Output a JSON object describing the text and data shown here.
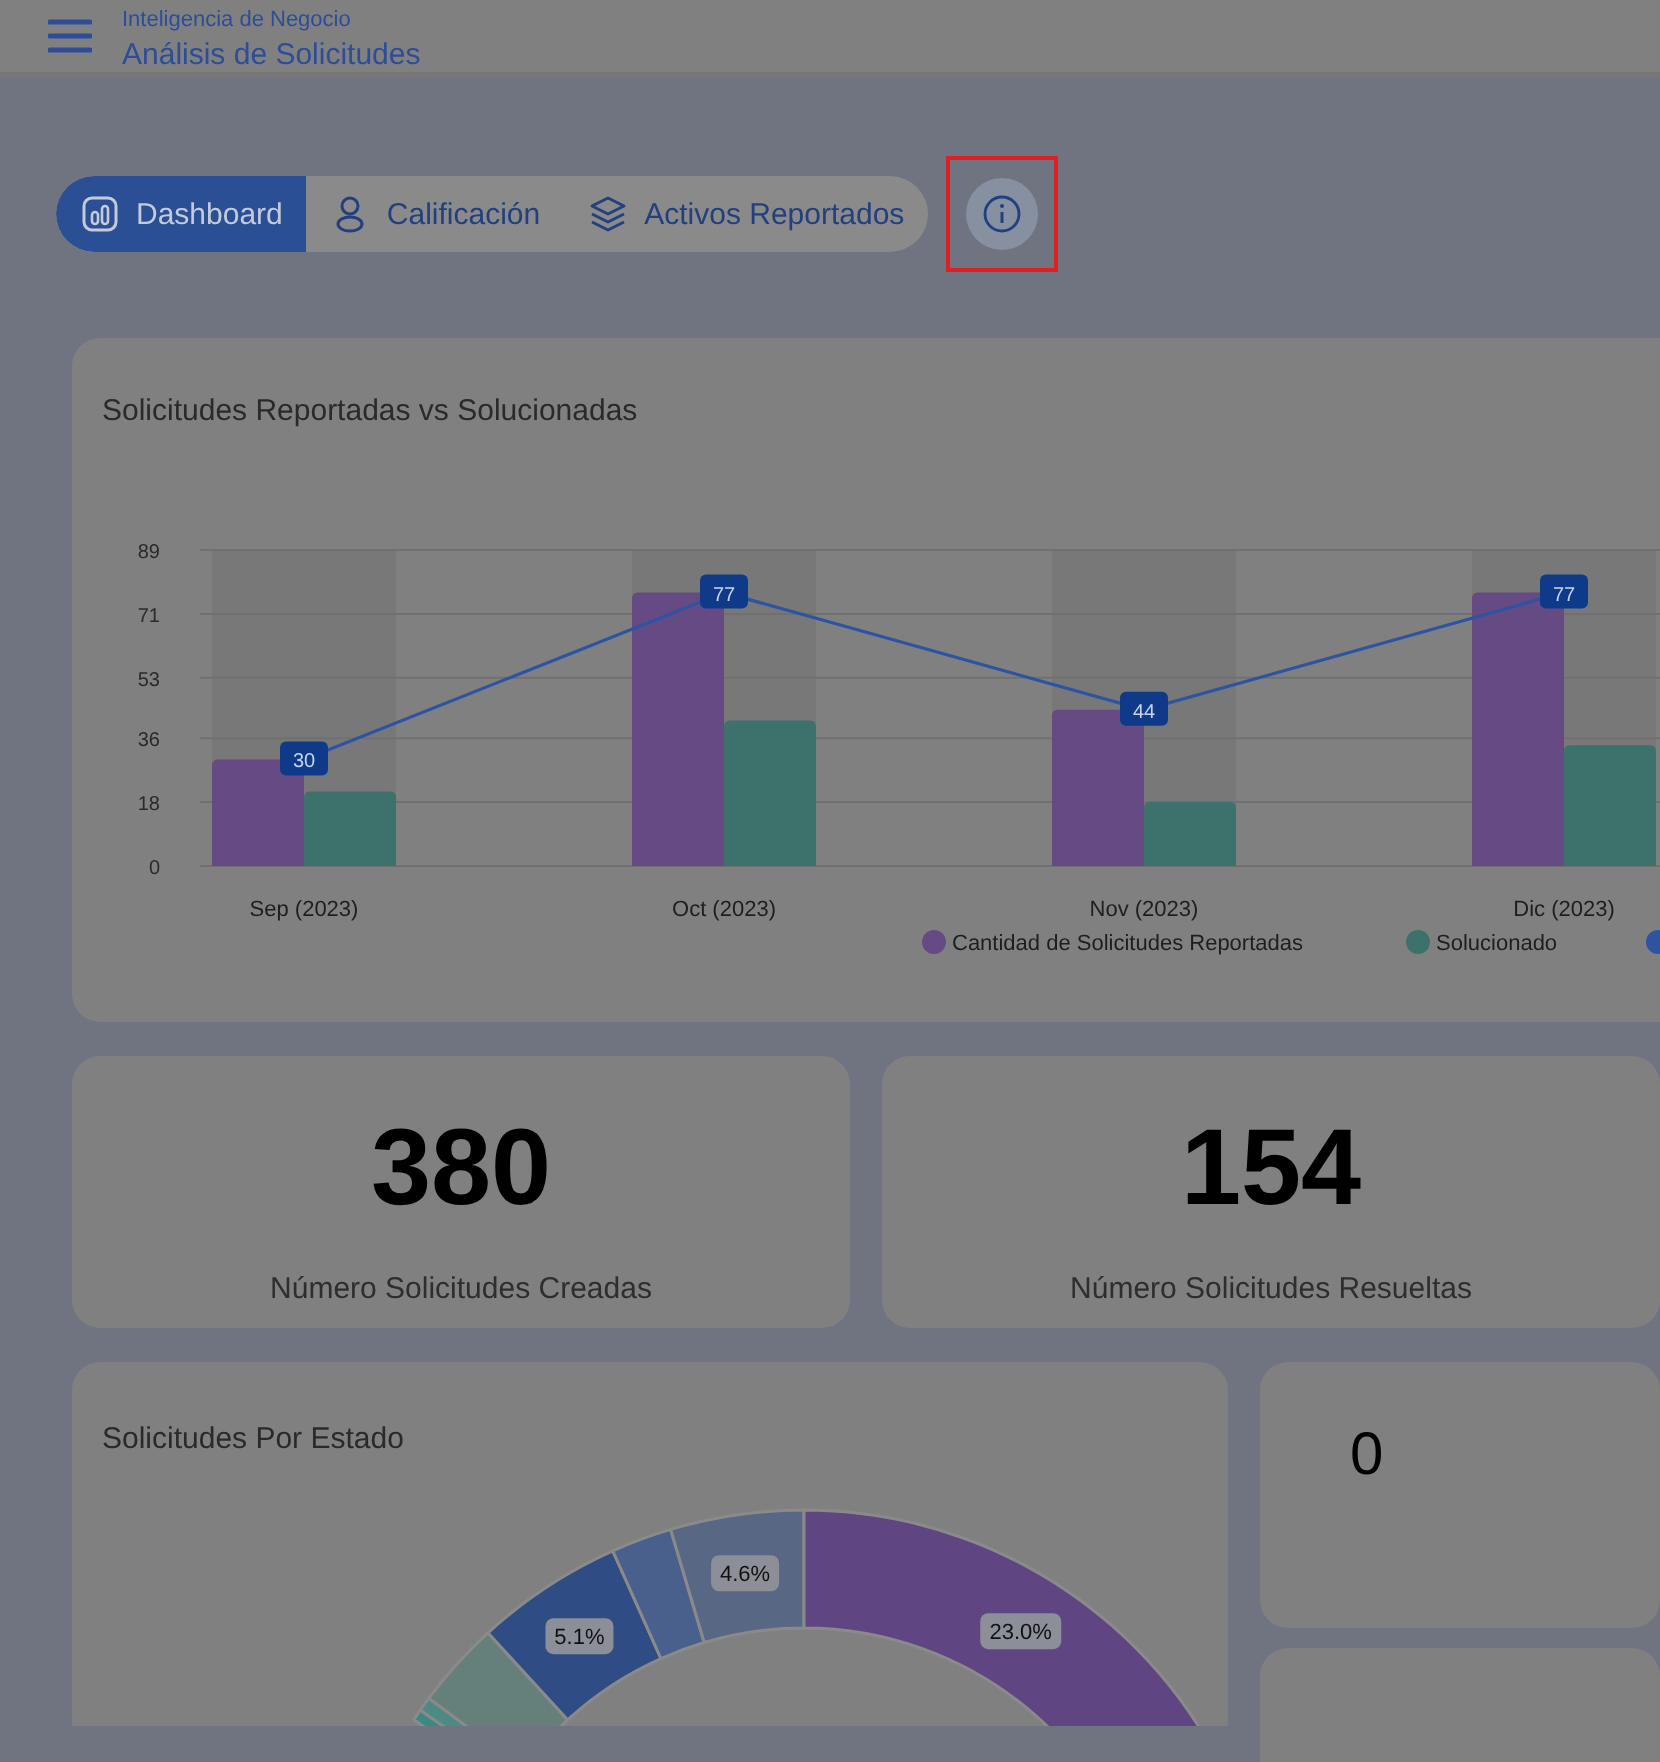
{
  "header": {
    "subtitle": "Inteligencia de Negocio",
    "title": "Análisis de Solicitudes"
  },
  "tabs": [
    {
      "label": "Dashboard",
      "selected": true
    },
    {
      "label": "Calificación",
      "selected": false
    },
    {
      "label": "Activos Reportados",
      "selected": false
    }
  ],
  "info_button": {
    "highlighted": true
  },
  "requests_chart": {
    "title": "Solicitudes Reportadas vs Solucionadas",
    "chart_data": {
      "type": "bar",
      "categories": [
        "Sep (2023)",
        "Oct (2023)",
        "Nov (2023)",
        "Dic (2023)"
      ],
      "ylim": [
        0,
        89
      ],
      "yticks": [
        0,
        18,
        36,
        53,
        71,
        89
      ],
      "series": [
        {
          "name": "Cantidad de Solicitudes Reportadas",
          "color": "#654a84",
          "values": [
            30,
            77,
            44,
            77
          ],
          "type": "bar"
        },
        {
          "name": "Solucionado",
          "color": "#3d716b",
          "values": [
            21,
            41,
            18,
            34
          ],
          "type": "bar"
        },
        {
          "color": "#2c54a3",
          "values": [
            30,
            77,
            44,
            77
          ],
          "type": "line",
          "marker": "square",
          "value_labels": [
            "30",
            "77",
            "44",
            "77"
          ]
        }
      ],
      "stacked": false,
      "grid": true,
      "legend": "bottom"
    }
  },
  "kpis": [
    {
      "value": "380",
      "label": "Número Solicitudes Creadas"
    },
    {
      "value": "154",
      "label": "Número Solicitudes Resueltas"
    }
  ],
  "status_chart": {
    "title": "Solicitudes Por Estado",
    "chart_data": {
      "type": "donut",
      "values": [
        0.4,
        0.5,
        3.0,
        5.1,
        2.1,
        4.6,
        23.0
      ],
      "colors": [
        "#3b8a80",
        "#4d8a84",
        "#657f7a",
        "#2f4c85",
        "#49608c",
        "#586783",
        "#5f4682"
      ],
      "value_labels": [
        null,
        null,
        null,
        "5.1%",
        null,
        "4.6%",
        "23.0%"
      ]
    }
  },
  "side_cards": [
    {
      "value": "0"
    }
  ]
}
